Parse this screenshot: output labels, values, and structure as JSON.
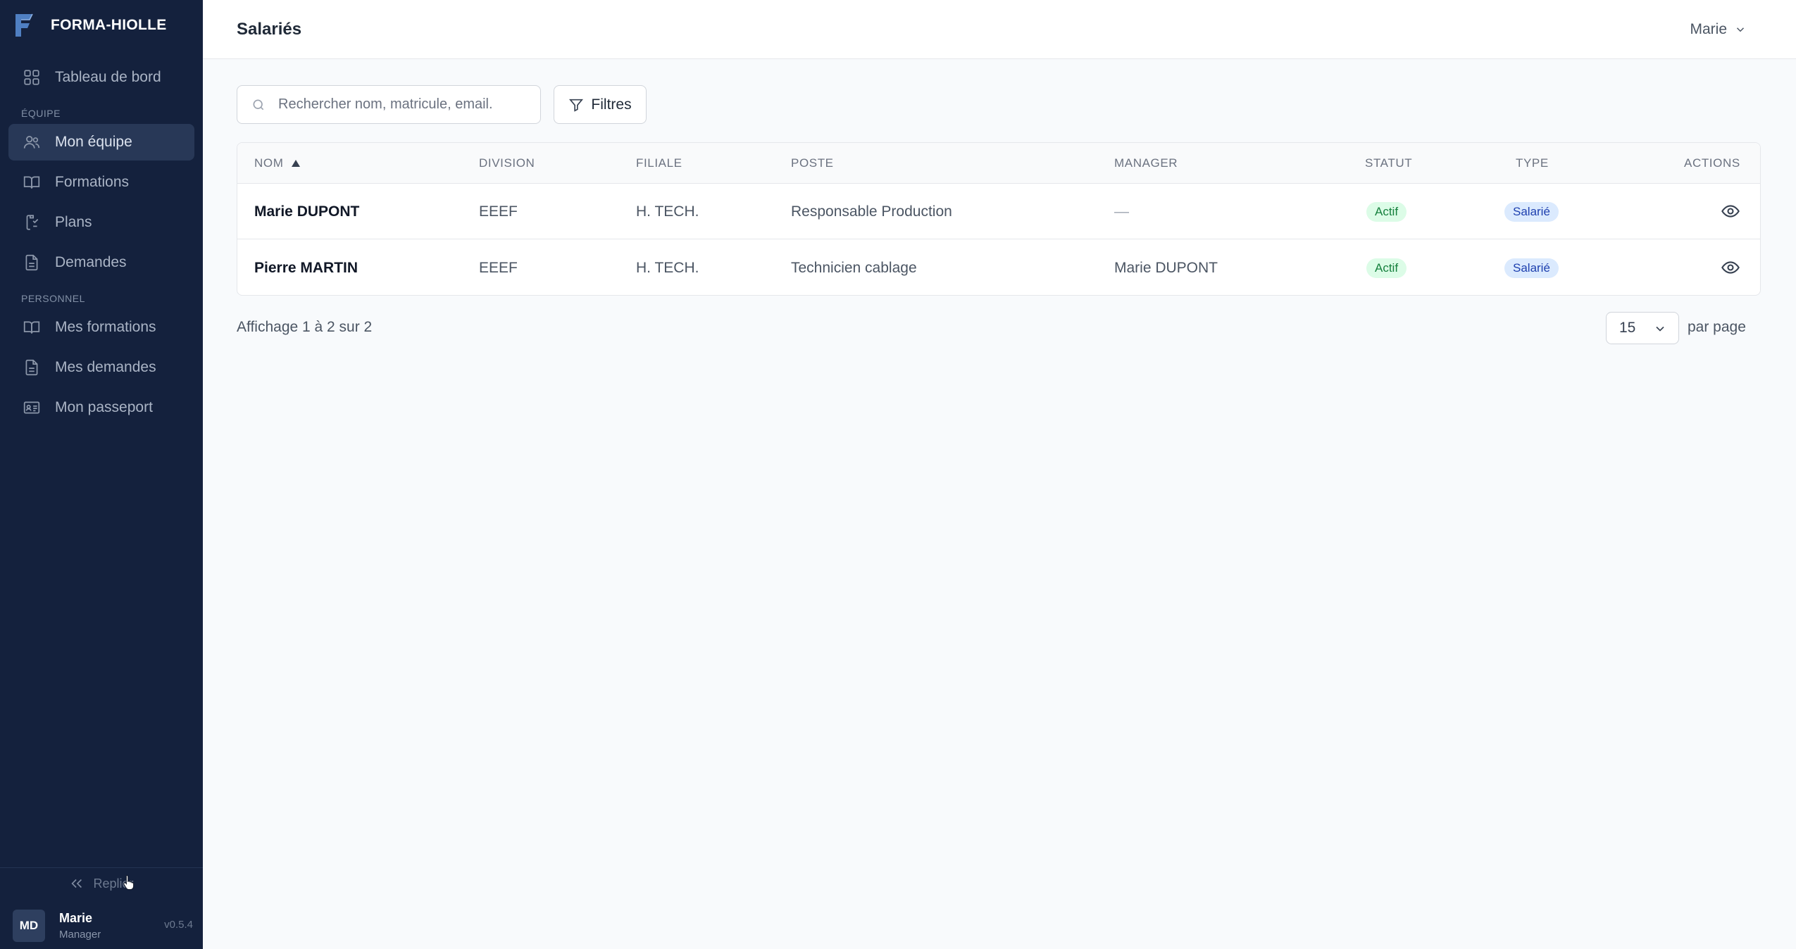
{
  "app": {
    "name": "FORMA-HIOLLE",
    "version": "v0.5.4"
  },
  "sidebar": {
    "items": [
      {
        "label": "Tableau de bord",
        "icon": "grid-icon"
      },
      {
        "label": "Mon équipe",
        "icon": "users-icon",
        "active": true
      },
      {
        "label": "Formations",
        "icon": "book-icon"
      },
      {
        "label": "Plans",
        "icon": "clipboard-icon"
      },
      {
        "label": "Demandes",
        "icon": "document-icon"
      },
      {
        "label": "Mes formations",
        "icon": "book-icon"
      },
      {
        "label": "Mes demandes",
        "icon": "document-icon"
      },
      {
        "label": "Mon passeport",
        "icon": "id-card-icon"
      }
    ],
    "sections": {
      "team": "ÉQUIPE",
      "personal": "PERSONNEL"
    },
    "collapse_label": "Replier",
    "user": {
      "initials": "MD",
      "name": "Marie",
      "role": "Manager"
    }
  },
  "header": {
    "title": "Salariés",
    "user_name": "Marie"
  },
  "toolbar": {
    "search_placeholder": "Rechercher nom, matricule, email.",
    "filters_label": "Filtres"
  },
  "table": {
    "columns": [
      "NOM",
      "DIVISION",
      "FILIALE",
      "POSTE",
      "MANAGER",
      "STATUT",
      "TYPE",
      "ACTIONS"
    ],
    "rows": [
      {
        "name": "Marie DUPONT",
        "division": "EEEF",
        "filiale": "H. TECH.",
        "poste": "Responsable Production",
        "manager": "—",
        "statut": "Actif",
        "type": "Salarié"
      },
      {
        "name": "Pierre MARTIN",
        "division": "EEEF",
        "filiale": "H. TECH.",
        "poste": "Technicien cablage",
        "manager": "Marie DUPONT",
        "statut": "Actif",
        "type": "Salarié"
      }
    ]
  },
  "pagination": {
    "summary": "Affichage 1 à 2 sur 2",
    "per_page_value": "15",
    "per_page_label": "par page"
  },
  "colors": {
    "sidebar_bg": "#14213d",
    "active_item_bg": "#283857",
    "status_green": "#15803d",
    "type_blue": "#1e40af"
  }
}
